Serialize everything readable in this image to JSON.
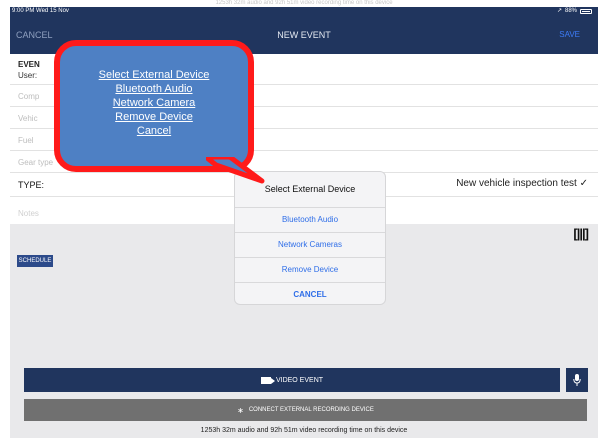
{
  "caption": "1253h 32m audio and 92h 51m video recording time on this device",
  "status": {
    "time": "9:00 PM  Wed 15 Nov",
    "battery": "88%"
  },
  "nav": {
    "cancel": "CANCEL",
    "title": "NEW EVENT",
    "save": "SAVE"
  },
  "form": {
    "event_label": "EVEN",
    "user_label": "User:",
    "comp_label": "Comp",
    "vehicle_label": "Vehic",
    "fuel_label": "Fuel",
    "gear_label": "Gear type",
    "type_label": "TYPE:",
    "type_value": "New vehicle inspection test",
    "notes_placeholder": "Notes",
    "schedule_label": "SCHEDULE"
  },
  "modal": {
    "title": "Select External Device",
    "items": [
      "Bluetooth Audio",
      "Network Cameras",
      "Remove Device"
    ],
    "cancel": "CANCEL"
  },
  "callout": {
    "lines": [
      "Select External Device",
      "Bluetooth Audio",
      "Network Camera",
      "Remove Device",
      "Cancel"
    ],
    "border_color": "#ff1a1a",
    "fill_color": "#4e80c4"
  },
  "actions": {
    "video_event": "VIDEO EVENT",
    "connect": "CONNECT EXTERNAL RECORDING DEVICE"
  },
  "footer": "1253h 32m audio and 92h 51m video recording time on this device",
  "colors": {
    "nav": "#20355e",
    "accent": "#2f6ee8",
    "connect": "#707070"
  }
}
